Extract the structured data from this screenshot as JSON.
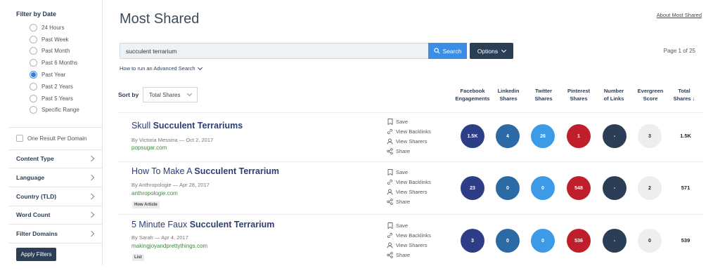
{
  "sidebar": {
    "filter_by_date_title": "Filter by Date",
    "date_options": [
      {
        "label": "24 Hours",
        "checked": false
      },
      {
        "label": "Past Week",
        "checked": false
      },
      {
        "label": "Past Month",
        "checked": false
      },
      {
        "label": "Past 6 Months",
        "checked": false
      },
      {
        "label": "Past Year",
        "checked": true
      },
      {
        "label": "Past 2 Years",
        "checked": false
      },
      {
        "label": "Past 5 Years",
        "checked": false
      },
      {
        "label": "Specific Range",
        "checked": false
      }
    ],
    "one_result_per_domain": "One Result Per Domain",
    "filters": [
      "Content Type",
      "Language",
      "Country (TLD)",
      "Word Count",
      "Filter Domains"
    ],
    "apply_filters": "Apply Filters"
  },
  "header": {
    "title": "Most Shared",
    "about_link": "About Most Shared",
    "page_info": "Page 1 of 25"
  },
  "search": {
    "value": "succulent terrarium",
    "button": "Search",
    "options_button": "Options",
    "advanced_link": "How to run an Advanced Search"
  },
  "sort": {
    "label": "Sort by",
    "selected": "Total Shares"
  },
  "columns": [
    {
      "line1": "Facebook",
      "line2": "Engagements"
    },
    {
      "line1": "Linkedin",
      "line2": "Shares"
    },
    {
      "line1": "Twitter",
      "line2": "Shares"
    },
    {
      "line1": "Pinterest",
      "line2": "Shares"
    },
    {
      "line1": "Number",
      "line2": "of Links"
    },
    {
      "line1": "Evergreen",
      "line2": "Score"
    },
    {
      "line1": "Total",
      "line2": "Shares ↓"
    }
  ],
  "actions": [
    "Save",
    "View Backlinks",
    "View Sharers",
    "Share"
  ],
  "colors": {
    "facebook": "#2d3e86",
    "linkedin": "#2c6aa6",
    "twitter": "#3d9ae6",
    "pinterest": "#bf1f2a",
    "links": "#2c3e55",
    "evergreen": "#eeeeee"
  },
  "articles": [
    {
      "title_plain": "Skull ",
      "title_bold": "Succulent Terrariums",
      "byline": "By Victoria Messina — Oct 2, 2017",
      "domain": "popsugar.com",
      "tag": "",
      "facebook": "1.5K",
      "linkedin": "4",
      "twitter": "26",
      "pinterest": "1",
      "links": "-",
      "evergreen": "3",
      "total": "1.5K"
    },
    {
      "title_plain": "How To Make A ",
      "title_bold": "Succulent Terrarium",
      "byline": "By Anthropologie — Apr 28, 2017",
      "domain": "anthropologie.com",
      "tag": "How Article",
      "facebook": "23",
      "linkedin": "0",
      "twitter": "0",
      "pinterest": "548",
      "links": "-",
      "evergreen": "2",
      "total": "571"
    },
    {
      "title_plain": "5 Minute Faux ",
      "title_bold": "Succulent Terrarium",
      "byline": "By Sarah — Apr 4, 2017",
      "domain": "makingjoyandprettythings.com",
      "tag": "List",
      "facebook": "3",
      "linkedin": "0",
      "twitter": "0",
      "pinterest": "536",
      "links": "-",
      "evergreen": "0",
      "total": "539"
    }
  ]
}
